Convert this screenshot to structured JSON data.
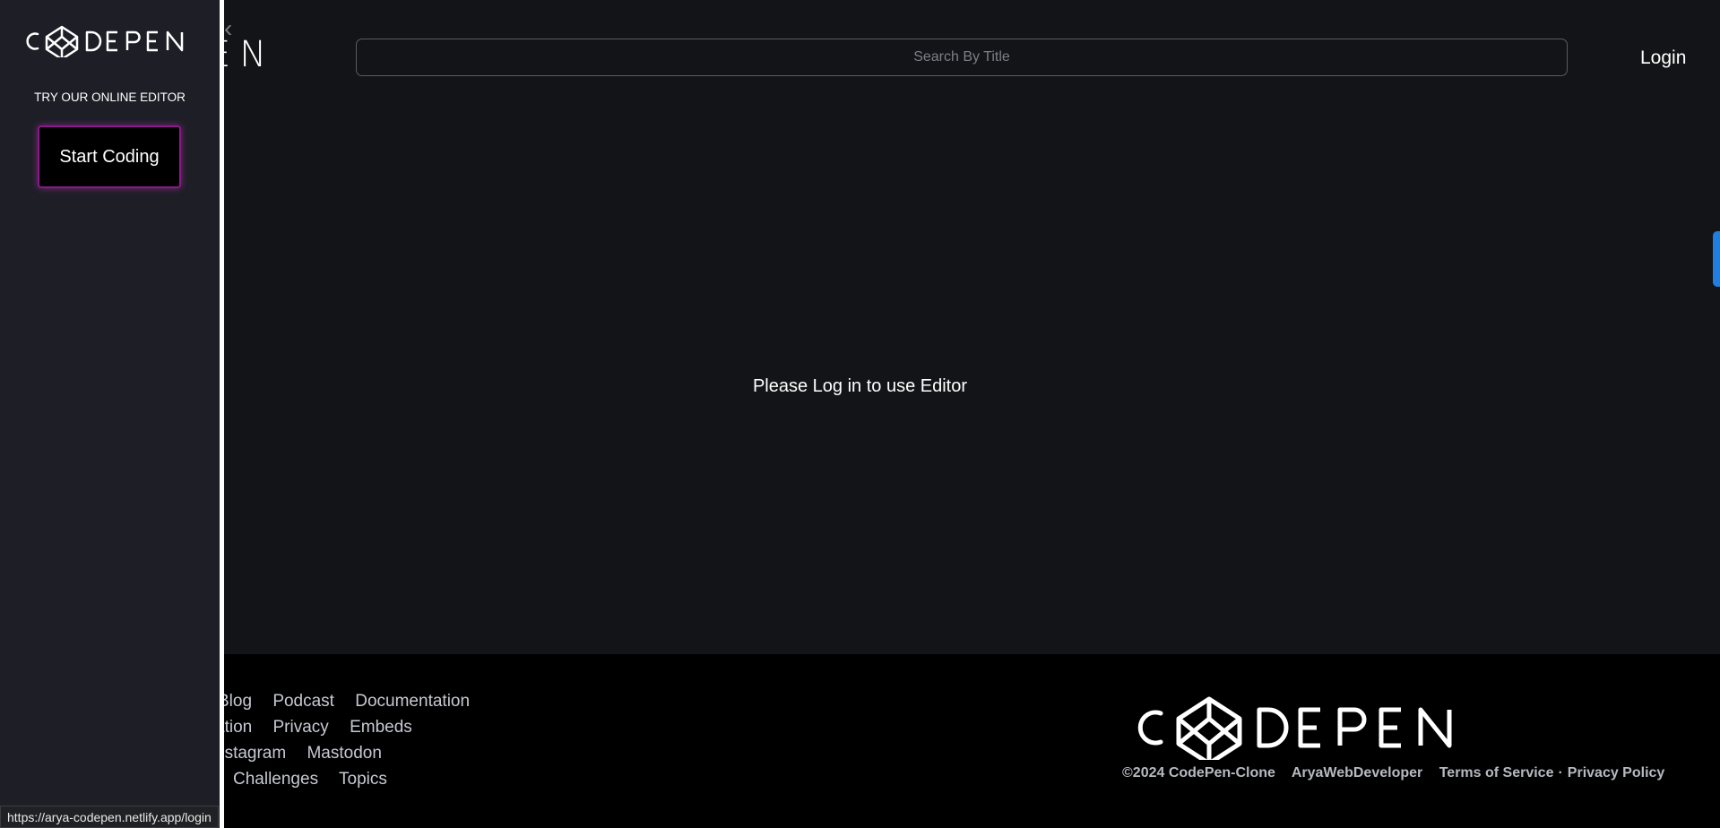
{
  "header": {
    "logo_partial": "EN",
    "search_placeholder": "Search By Title",
    "login_label": "Login"
  },
  "main": {
    "message": "Please Log in to use Editor"
  },
  "sidebar": {
    "logo_text": "CODEPEN",
    "tagline": "TRY OUR ONLINE EDITOR",
    "start_button_label": "Start Coding"
  },
  "footer": {
    "links_row1": [
      "Blog",
      "Podcast",
      "Documentation"
    ],
    "links_row2": [
      "ation",
      "Privacy",
      "Embeds"
    ],
    "links_row3": [
      "nstagram",
      "Mastodon"
    ],
    "links_row4": [
      "Challenges",
      "Topics"
    ],
    "logo_text": "CODEPEN",
    "copyright": "©2024 CodePen-Clone",
    "author": "AryaWebDeveloper",
    "terms": "Terms of Service",
    "dot": "·",
    "privacy_policy": "Privacy Policy"
  },
  "status_bar": {
    "url": "https://arya-codepen.netlify.app/login"
  },
  "colors": {
    "background": "#131417",
    "sidebar": "#1e1f26",
    "footer": "#000000",
    "accent_glow": "#c828c8",
    "side_tab": "#1f7ee0"
  },
  "icons": {
    "logo_cube": "codepen-cube-icon",
    "back": "chevron-left-icon"
  }
}
